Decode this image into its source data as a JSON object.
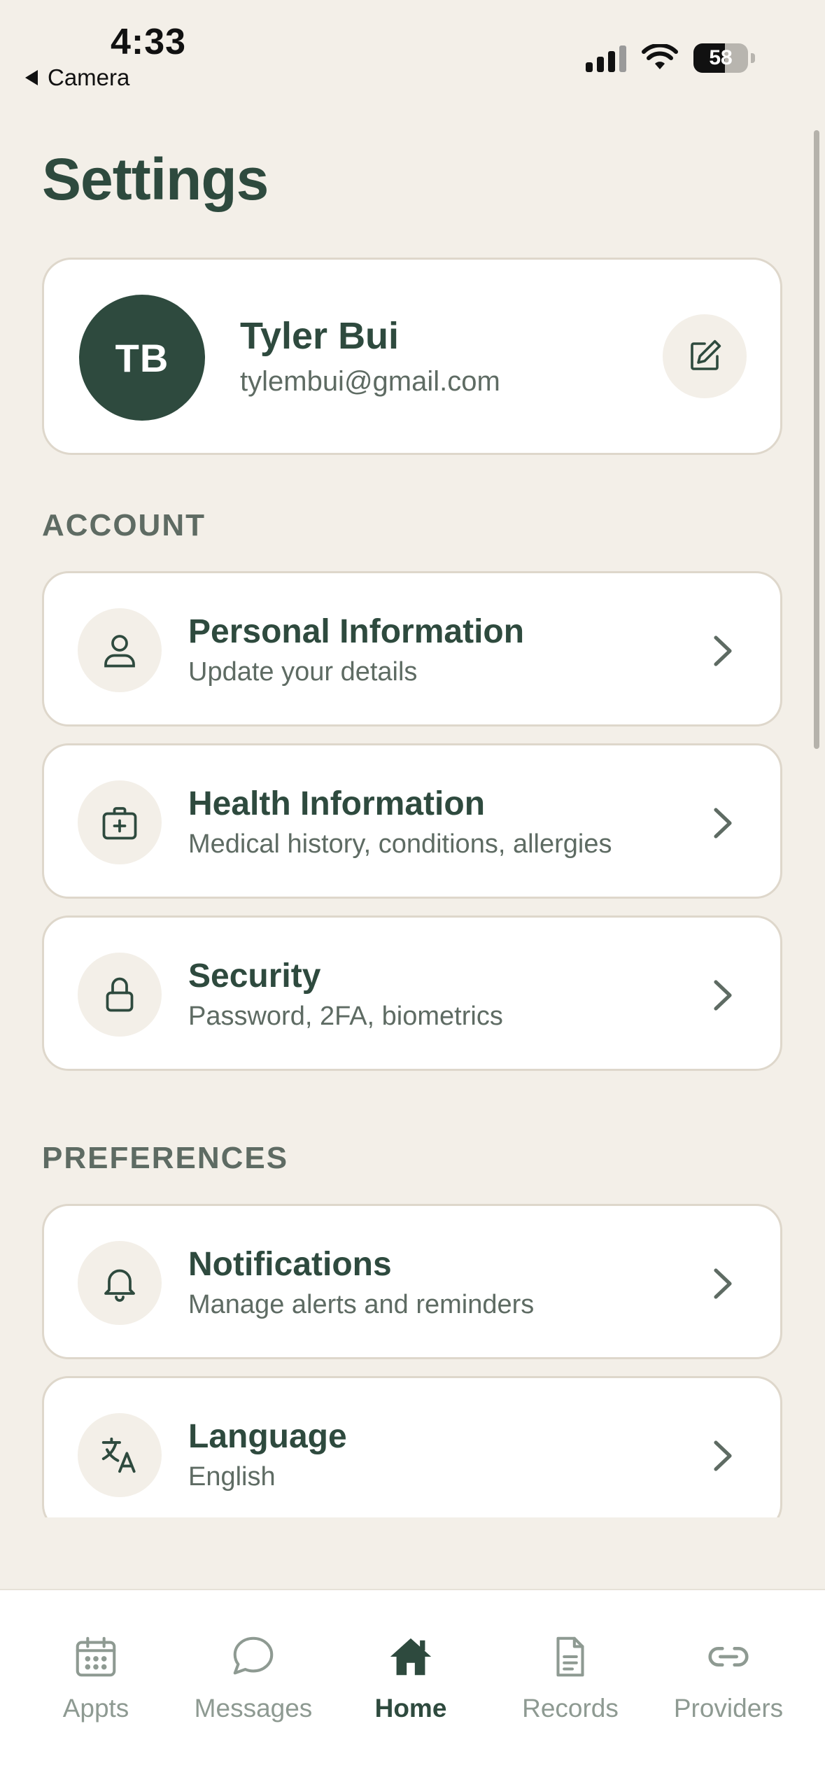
{
  "status_bar": {
    "time": "4:33",
    "back_label": "Camera",
    "battery": "58"
  },
  "page": {
    "title": "Settings"
  },
  "profile": {
    "initials": "TB",
    "name": "Tyler Bui",
    "email": "tylembui@gmail.com"
  },
  "sections": {
    "account": {
      "label": "ACCOUNT",
      "items": [
        {
          "title": "Personal Information",
          "subtitle": "Update your details",
          "icon": "person-icon"
        },
        {
          "title": "Health Information",
          "subtitle": "Medical history, conditions, allergies",
          "icon": "medical-kit-icon"
        },
        {
          "title": "Security",
          "subtitle": "Password, 2FA, biometrics",
          "icon": "lock-icon"
        }
      ]
    },
    "preferences": {
      "label": "PREFERENCES",
      "items": [
        {
          "title": "Notifications",
          "subtitle": "Manage alerts and reminders",
          "icon": "bell-icon"
        },
        {
          "title": "Language",
          "subtitle": "English",
          "icon": "translate-icon"
        }
      ]
    }
  },
  "tabbar": {
    "items": [
      {
        "label": "Appts",
        "icon": "calendar-icon",
        "active": false
      },
      {
        "label": "Messages",
        "icon": "chat-bubble-icon",
        "active": false
      },
      {
        "label": "Home",
        "icon": "home-icon",
        "active": true
      },
      {
        "label": "Records",
        "icon": "document-icon",
        "active": false
      },
      {
        "label": "Providers",
        "icon": "link-icon",
        "active": false
      }
    ]
  },
  "colors": {
    "primary": "#2E4A3E",
    "background": "#F3EFE8",
    "card": "#FFFFFF",
    "muted": "#5E6B63",
    "inactive_tab": "#8E9A92"
  }
}
